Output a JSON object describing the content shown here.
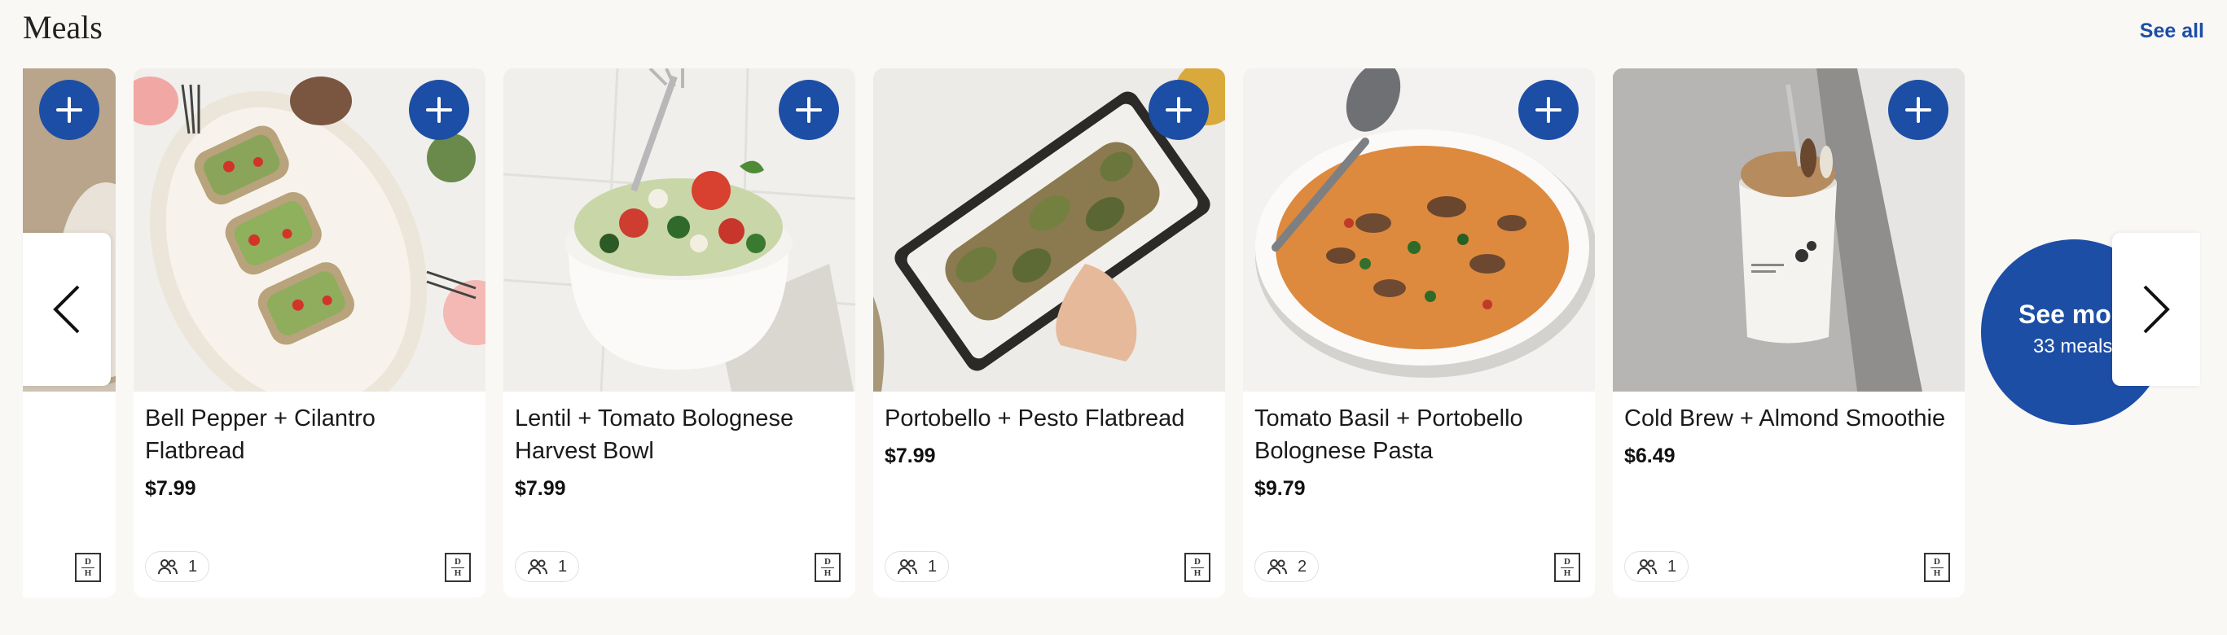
{
  "section": {
    "title": "Meals",
    "see_all_label": "See all"
  },
  "cards": [
    {
      "name": "",
      "price": "",
      "serves": ""
    },
    {
      "name": "Bell Pepper + Cilantro Flatbread",
      "price": "$7.99",
      "serves": "1"
    },
    {
      "name": "Lentil + Tomato Bolognese Harvest Bowl",
      "price": "$7.99",
      "serves": "1"
    },
    {
      "name": "Portobello + Pesto Flatbread",
      "price": "$7.99",
      "serves": "1"
    },
    {
      "name": "Tomato Basil + Portobello Bolognese Pasta",
      "price": "$9.79",
      "serves": "2"
    },
    {
      "name": "Cold Brew + Almond Smoothie",
      "price": "$6.49",
      "serves": "1"
    }
  ],
  "see_more": {
    "title": "See more",
    "subtitle": "33 meals"
  },
  "logo": {
    "top": "D",
    "bottom": "H"
  },
  "colors": {
    "accent": "#1d4ea6",
    "background": "#f9f8f5"
  }
}
